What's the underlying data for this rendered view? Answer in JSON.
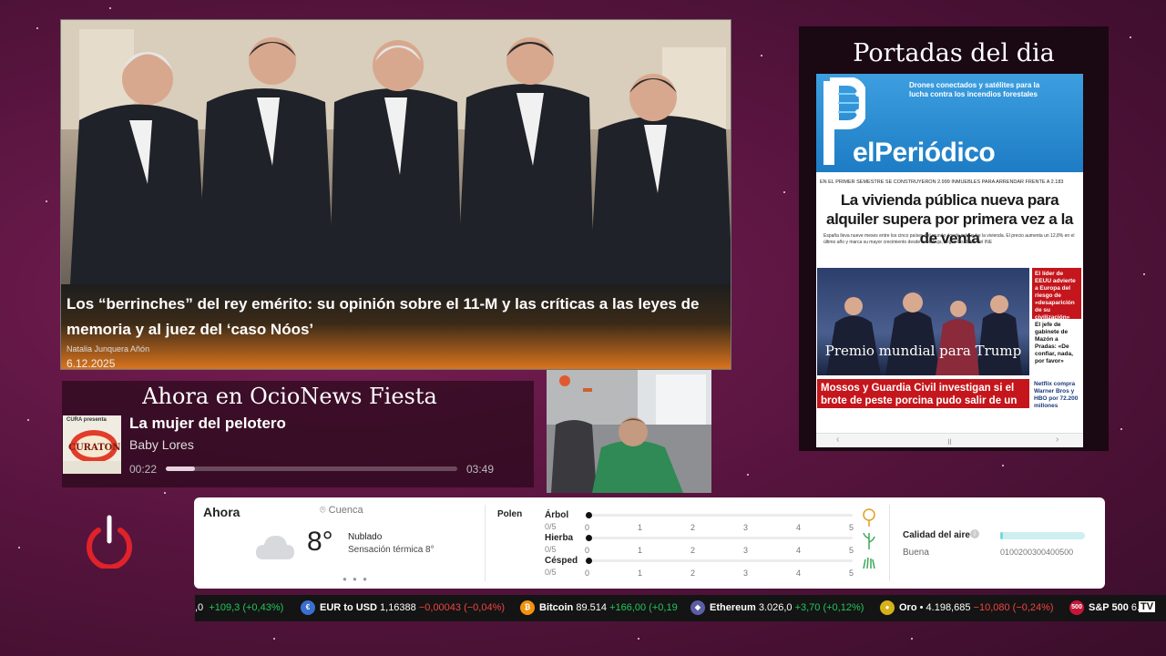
{
  "news": {
    "title": "Los “berrinches” del rey emérito: su opinión sobre el 11-M y las críticas a las leyes de memoria y al juez del ‘caso Nóos’",
    "author": "Natalia Junquera Añón",
    "date": "6.12.2025"
  },
  "portadas": {
    "title": "Portadas del dia",
    "paper": {
      "promo": "Drones conectados y satélites para la lucha contra los incendios forestales",
      "name": "elPeriódico",
      "strip": "EN EL PRIMER SEMESTRE SE CONSTRUYERON 2.999 INMUEBLES PARA ARRENDAR FRENTE A 2.183",
      "headline": "La vivienda pública nueva para alquiler supera por primera vez a la de venta",
      "sub": "España lleva nueve meses entre los cinco países del mundo donde más sube la vivienda. El precio aumenta un 12,8% en el último año y marca su mayor crecimiento desde la burbuja, según los datos del INE",
      "photo_caption": "Premio mundial para Trump",
      "side_red": "El líder de EEUU advierte a Europa del riesgo de «desaparición de su civilización»",
      "side_text": "El jefe de gabinete de Mazón a Pradas: «De confiar, nada, por favor»",
      "bottom": "Mossos y Guardia Civil investigan si el brote de peste porcina pudo salir de un laboratorio",
      "bottom_side": "Netflix compra Warner Bros y HBO por 72.200 millones",
      "nav_prev": "‹",
      "nav_pause": "॥",
      "nav_next": "›"
    }
  },
  "player": {
    "heading": "Ahora en OcioNews Fiesta",
    "album_text": "CURATON",
    "album_top": "CURA presenta",
    "song": "La mujer del pelotero",
    "artist": "Baby Lores",
    "elapsed": "00:22",
    "total": "03:49",
    "progress": 0.1
  },
  "weather": {
    "now_label": "Ahora",
    "location": "Cuenca",
    "temperature": "8°",
    "condition": "Nublado",
    "feels_like": "Sensación térmica 8°",
    "pager": "● ● ●",
    "polen_label": "Polen",
    "pollen": [
      {
        "name": "Árbol",
        "value": "0/5",
        "icon": "tree-icon"
      },
      {
        "name": "Hierba",
        "value": "0/5",
        "icon": "herb-icon"
      },
      {
        "name": "Césped",
        "value": "0/5",
        "icon": "grass-icon"
      }
    ],
    "pollen_scale": [
      "0",
      "1",
      "2",
      "3",
      "4",
      "5"
    ],
    "air_quality_label": "Calidad del aire",
    "air_quality_state": "Buena",
    "air_scale": "0100200300400500",
    "air_quality_value": 0
  },
  "ticker": {
    "partial_value": ",0",
    "partial_change": "+109,3 (+0,43%)",
    "items": [
      {
        "name": "EUR to USD",
        "price": "1,16388",
        "change": "−0,00043 (−0,04%)",
        "dir": "neg",
        "icon": "eur-usd-icon"
      },
      {
        "name": "Bitcoin",
        "price": "89.514",
        "change": "+166,00 (+0,19",
        "dir": "pos",
        "icon": "bitcoin-icon"
      },
      {
        "name": "Ethereum",
        "price": "3.026,0",
        "change": "+3,70 (+0,12%)",
        "dir": "pos",
        "icon": "ethereum-icon"
      },
      {
        "name": "Oro",
        "price": "4.198,685",
        "change": "−10,080 (−0,24%)",
        "dir": "neg",
        "icon": "gold-icon"
      },
      {
        "name": "S&P 500",
        "price": "6.8",
        "change": "",
        "dir": "pos",
        "icon": "sp500-icon"
      }
    ],
    "sp_badge": "500",
    "tv_logo": "TV"
  },
  "colors": {
    "background": "#5a1540",
    "positive": "#22c55e",
    "negative": "#f04444",
    "paper_blue": "#1d7cc4",
    "paper_red": "#c4161c"
  }
}
